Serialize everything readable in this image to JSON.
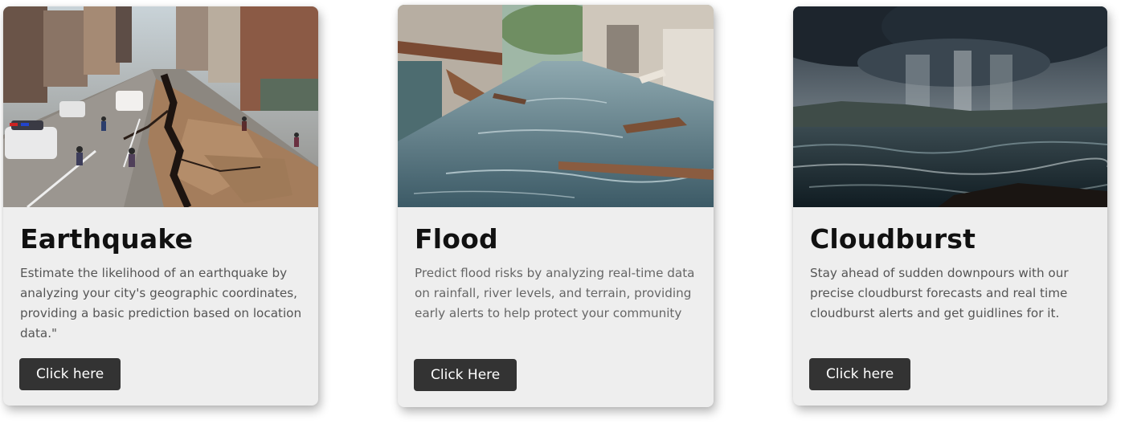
{
  "cards": [
    {
      "id": "earthquake",
      "title": "Earthquake",
      "description": "Estimate the likelihood of an earthquake by analyzing your city's geographic coordinates, providing a basic prediction based on location data.\"",
      "button_label": "Click here",
      "image_subject": "city street split by an earthquake fissure"
    },
    {
      "id": "flood",
      "title": "Flood",
      "description": "Predict flood risks by analyzing real-time data on rainfall, river levels, and terrain, providing early alerts to help protect your community",
      "button_label": "Click Here",
      "image_subject": "flooded street with debris"
    },
    {
      "id": "cloudburst",
      "title": "Cloudburst",
      "description": "Stay ahead of sudden downpours with our precise cloudburst forecasts and real time cloudburst alerts and get guidlines for it.",
      "button_label": "Click here",
      "image_subject": "storm cloud raining over a sea"
    }
  ],
  "colors": {
    "card_background": "#eeeeee",
    "button_background": "#333333",
    "button_text": "#ffffff",
    "title_text": "#111111",
    "body_text": "#555555"
  }
}
